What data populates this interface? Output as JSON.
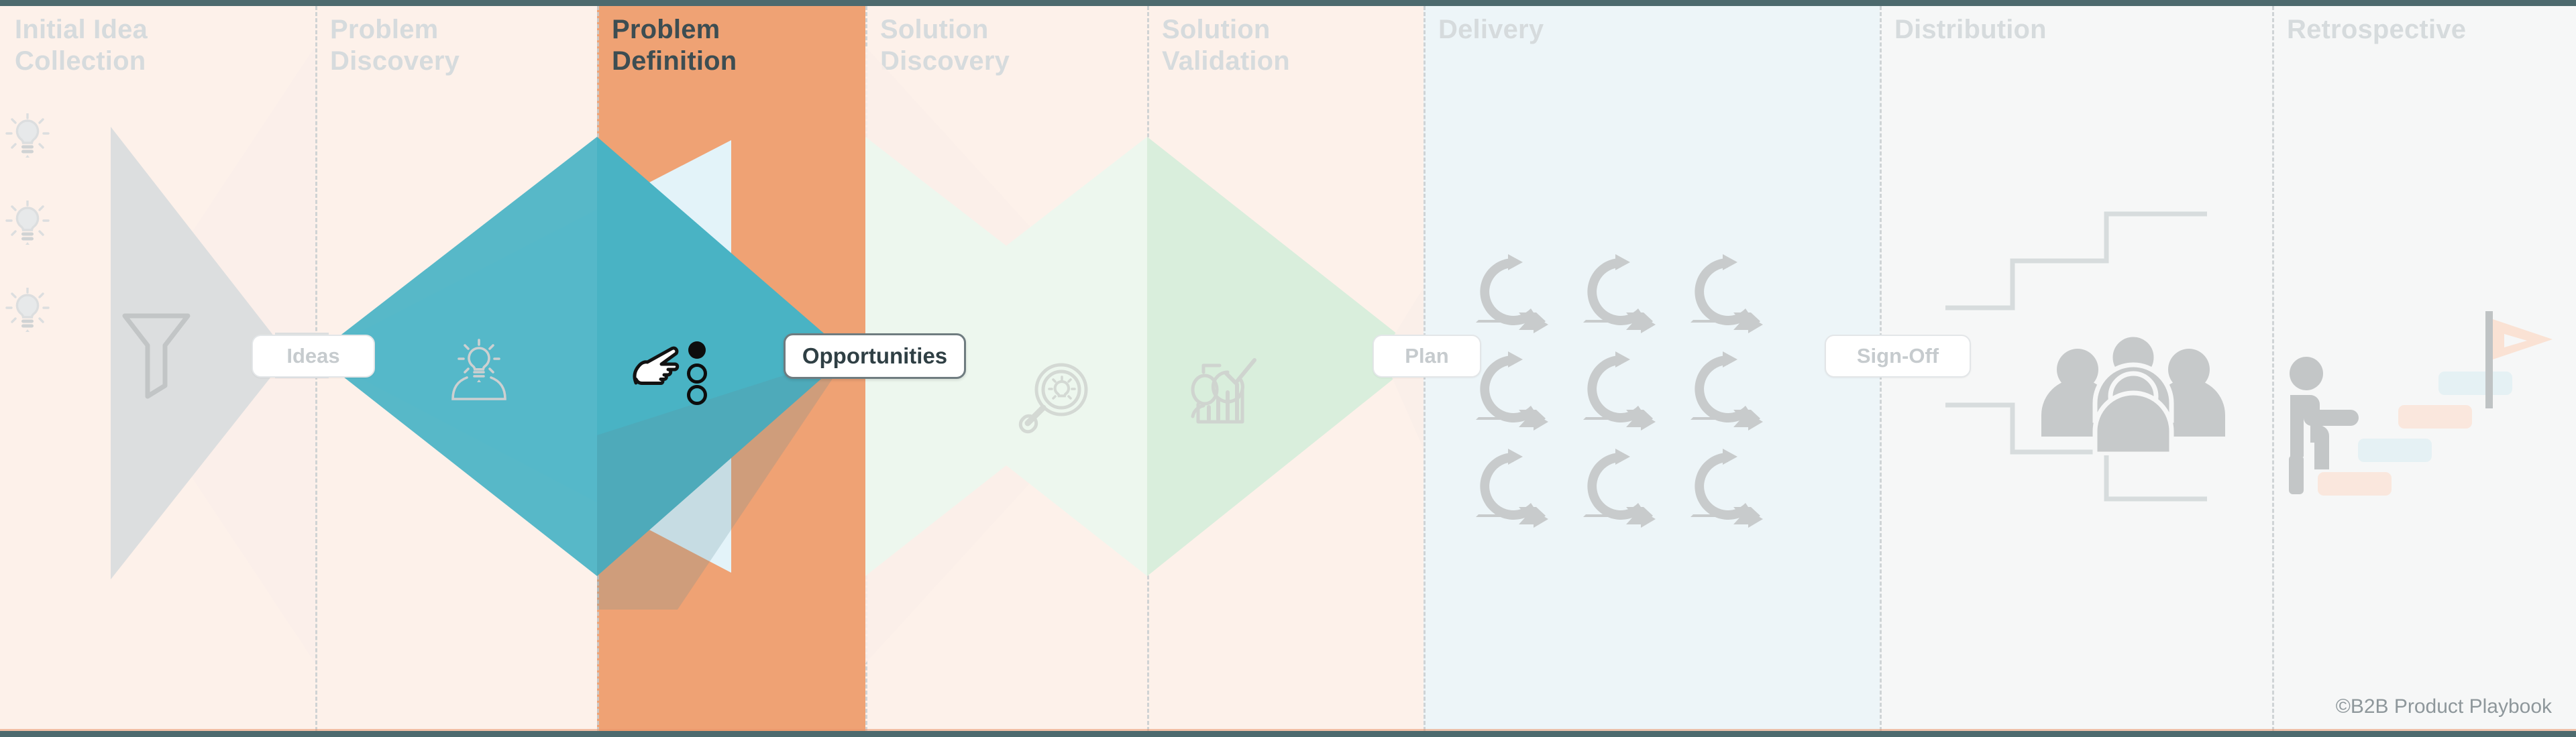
{
  "diagram": {
    "title_semantic": "double-diamond-product-process",
    "credit": "©B2B Product Playbook",
    "active_phase": "Problem Definition",
    "colors": {
      "rule": "#4d6a6e",
      "peach_band": "#fdf1ea",
      "blue_band": "#edf5f8",
      "gray_band": "#f6f7f7",
      "active_orange": "#efa274",
      "active_teal": "#49b3c4",
      "divider": "#c9ced1",
      "muted_title": "#d6dbdd",
      "active_title": "#3d4d52",
      "icon_gray": "#c9cccd",
      "funnel_gray": "#dcdedf",
      "diamond_blue": "#e3f3f9",
      "diamond_green": "#d9eedc",
      "diamond_green_pale": "#edf7ee",
      "diamond_peach": "#faeee9"
    }
  },
  "phases": [
    {
      "id": "initial-idea-collection",
      "label": "Initial Idea\nCollection",
      "active": false,
      "band": "peach"
    },
    {
      "id": "problem-discovery",
      "label": "Problem\nDiscovery",
      "active": false,
      "band": "peach"
    },
    {
      "id": "problem-definition",
      "label": "Problem\nDefinition",
      "active": true,
      "band": "orange"
    },
    {
      "id": "solution-discovery",
      "label": "Solution\nDiscovery",
      "active": false,
      "band": "peach"
    },
    {
      "id": "solution-validation",
      "label": "Solution\nValidation",
      "active": false,
      "band": "peach"
    },
    {
      "id": "delivery",
      "label": "Delivery",
      "active": false,
      "band": "blue"
    },
    {
      "id": "distribution",
      "label": "Distribution",
      "active": false,
      "band": "gray"
    },
    {
      "id": "retrospective",
      "label": "Retrospective",
      "active": false,
      "band": "gray"
    }
  ],
  "artifacts": [
    {
      "id": "ideas",
      "label": "Ideas",
      "emphasis": "muted"
    },
    {
      "id": "opportunities",
      "label": "Opportunities",
      "emphasis": "strong"
    },
    {
      "id": "plan",
      "label": "Plan",
      "emphasis": "muted"
    },
    {
      "id": "sign-off",
      "label": "Sign-Off",
      "emphasis": "muted"
    }
  ],
  "icons": [
    {
      "id": "lightbulb-1",
      "name": "lightbulb-icon",
      "phase": "initial-idea-collection"
    },
    {
      "id": "lightbulb-2",
      "name": "lightbulb-icon",
      "phase": "initial-idea-collection"
    },
    {
      "id": "lightbulb-3",
      "name": "lightbulb-icon",
      "phase": "initial-idea-collection"
    },
    {
      "id": "funnel",
      "name": "funnel-icon",
      "phase": "initial-idea-collection"
    },
    {
      "id": "person-idea",
      "name": "person-lightbulb-icon",
      "phase": "problem-discovery"
    },
    {
      "id": "hand-select",
      "name": "hand-pointer-select-icon",
      "phase": "problem-definition"
    },
    {
      "id": "magnifier-idea",
      "name": "magnifier-lightbulb-icon",
      "phase": "solution-discovery"
    },
    {
      "id": "validation-chart",
      "name": "person-chart-check-icon",
      "phase": "solution-validation"
    },
    {
      "id": "sprint-grid",
      "name": "sprint-cycle-icon-grid",
      "phase": "delivery",
      "count": 9
    },
    {
      "id": "audience-group",
      "name": "people-group-icon",
      "phase": "distribution"
    },
    {
      "id": "climb-steps",
      "name": "person-climbing-steps-icon",
      "phase": "retrospective"
    },
    {
      "id": "goal-flag",
      "name": "flag-icon",
      "phase": "retrospective"
    }
  ]
}
